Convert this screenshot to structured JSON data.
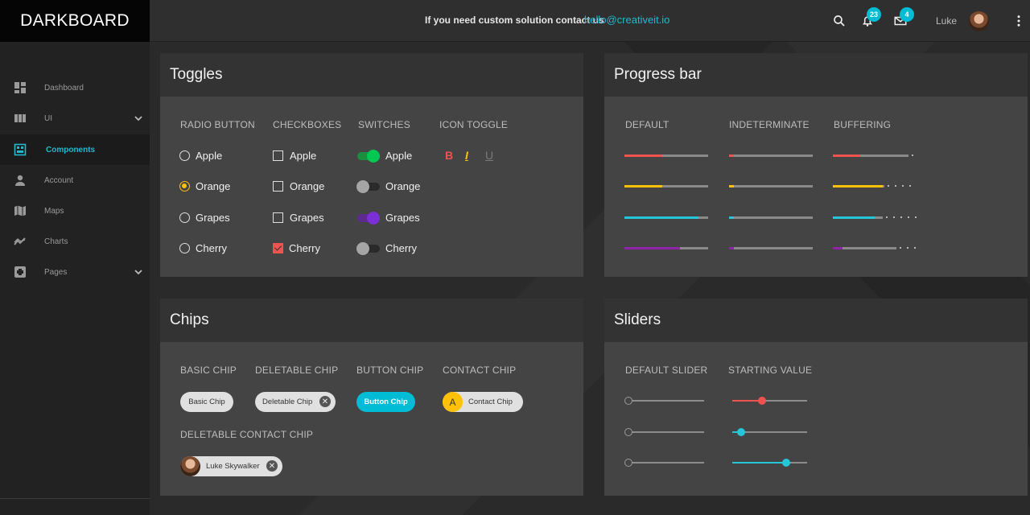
{
  "app": {
    "brand": "DARKBOARD"
  },
  "header": {
    "message": "If you need custom solution contact us",
    "email": "hello@creativeit.io",
    "notifications_count": "23",
    "messages_count": "4",
    "user_name": "Luke",
    "icons": [
      "search-icon",
      "bell-icon",
      "mail-icon",
      "more-vert-icon"
    ]
  },
  "sidebar": {
    "items": [
      {
        "label": "Dashboard",
        "icon": "dashboard-icon",
        "has_children": false
      },
      {
        "label": "UI",
        "icon": "view-week-icon",
        "has_children": true
      },
      {
        "label": "Components",
        "icon": "components-icon",
        "has_children": false,
        "active": true
      },
      {
        "label": "Account",
        "icon": "person-icon",
        "has_children": false
      },
      {
        "label": "Maps",
        "icon": "map-icon",
        "has_children": false
      },
      {
        "label": "Charts",
        "icon": "trending-icon",
        "has_children": false
      },
      {
        "label": "Pages",
        "icon": "pages-icon",
        "has_children": true
      }
    ]
  },
  "toggles": {
    "title": "Toggles",
    "radio": {
      "header": "RADIO BUTTON",
      "options": [
        "Apple",
        "Orange",
        "Grapes",
        "Cherry"
      ],
      "selected": "Orange"
    },
    "checkboxes": {
      "header": "CHECKBOXES",
      "options": [
        "Apple",
        "Orange",
        "Grapes",
        "Cherry"
      ],
      "checked": [
        "Cherry"
      ]
    },
    "switches": {
      "header": "SWITCHES",
      "options": [
        "Apple",
        "Orange",
        "Grapes",
        "Cherry"
      ],
      "on": [
        "Apple",
        "Grapes"
      ]
    },
    "icon_toggle": {
      "header": "ICON TOGGLE",
      "items": [
        "B",
        "I",
        "U"
      ],
      "active": [
        "B",
        "I"
      ]
    }
  },
  "progress": {
    "title": "Progress bar",
    "headers": [
      "DEFAULT",
      "INDETERMINATE",
      "BUFFERING"
    ],
    "colors": [
      "#ef5350",
      "#ffc107",
      "#26c6da",
      "#8e24aa"
    ],
    "default_values": [
      0.45,
      0.45,
      0.88,
      0.66
    ],
    "indeterminate_values": [
      0.06,
      0.06,
      0.06,
      0.06
    ],
    "buffering_values": [
      0.33,
      0.6,
      0.5,
      0.12
    ],
    "buffering_buffer": [
      0.9,
      0.62,
      0.6,
      0.76
    ]
  },
  "chips": {
    "title": "Chips",
    "headers": [
      "BASIC CHIP",
      "DELETABLE CHIP",
      "BUTTON CHIP",
      "CONTACT CHIP",
      "DELETABLE CONTACT CHIP"
    ],
    "basic": "Basic Chip",
    "deletable": "Deletable Chip",
    "button": "Button Chip",
    "contact_initial": "A",
    "contact": "Contact Chip",
    "deletable_contact": "Luke Skywalker"
  },
  "sliders": {
    "title": "Sliders",
    "headers": [
      "DEFAULT SLIDER",
      "STARTING VALUE"
    ],
    "default_values": [
      0,
      0,
      0
    ],
    "starting_values": [
      0.4,
      0.12,
      0.72
    ],
    "starting_colors": [
      "#ef5350",
      "#26c6da",
      "#26c6da"
    ]
  }
}
